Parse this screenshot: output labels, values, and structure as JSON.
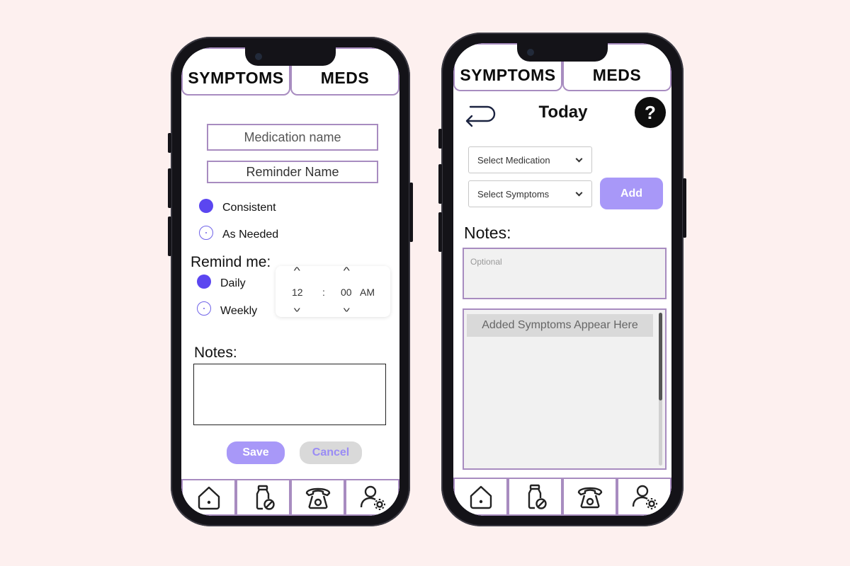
{
  "left_phone": {
    "tabs": [
      "SYMPTOMS",
      "MEDS"
    ],
    "medication_placeholder": "Medication name",
    "reminder_placeholder": "Reminder Name",
    "frequency_options": [
      {
        "label": "Consistent",
        "selected": true
      },
      {
        "label": "As Needed",
        "selected": false
      }
    ],
    "remind_label": "Remind me:",
    "remind_options": [
      {
        "label": "Daily",
        "selected": true
      },
      {
        "label": "Weekly",
        "selected": false
      }
    ],
    "time_picker": {
      "hour": "12",
      "separator": ":",
      "minute": "00",
      "period": "AM"
    },
    "notes_label": "Notes:",
    "save_label": "Save",
    "cancel_label": "Cancel",
    "nav": [
      "home-icon",
      "medication-icon",
      "telephone-icon",
      "user-settings-icon"
    ]
  },
  "right_phone": {
    "tabs": [
      "SYMPTOMS",
      "MEDS"
    ],
    "title": "Today",
    "help_label": "?",
    "select_medication": "Select Medication",
    "select_symptoms": "Select Symptoms",
    "add_label": "Add",
    "notes_label": "Notes:",
    "notes_placeholder": "Optional",
    "symptoms_placeholder": "Added Symptoms Appear Here",
    "nav": [
      "home-icon",
      "medication-icon",
      "telephone-icon",
      "user-settings-icon"
    ]
  },
  "colors": {
    "background": "#fdf0ef",
    "accent": "#a88cc0",
    "primary_button": "#a898f8",
    "radio": "#5b46f0",
    "cancel_bg": "#d9d9d9"
  }
}
